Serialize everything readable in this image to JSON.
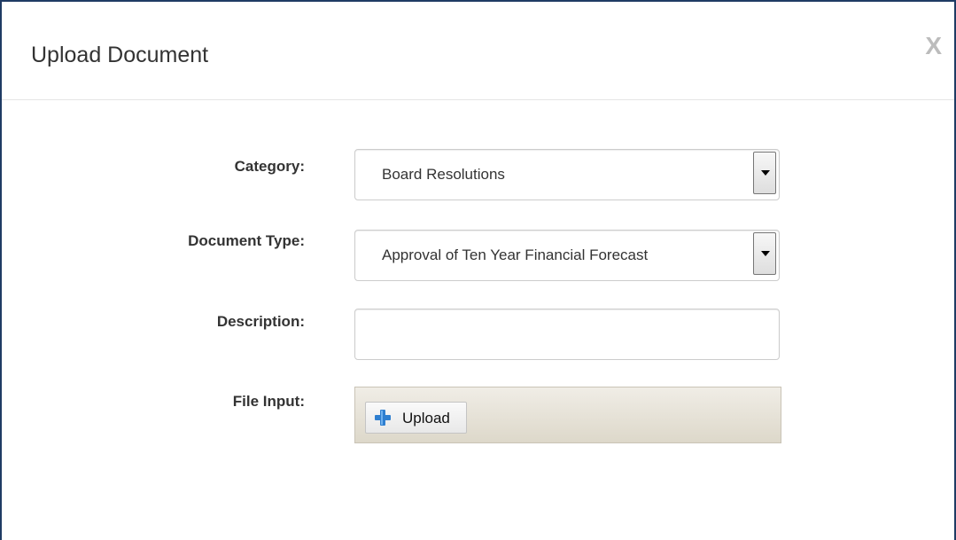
{
  "dialog": {
    "title": "Upload Document",
    "close_label": "X"
  },
  "form": {
    "category": {
      "label": "Category:",
      "value": "Board Resolutions"
    },
    "document_type": {
      "label": "Document Type:",
      "value": "Approval of Ten Year Financial Forecast"
    },
    "description": {
      "label": "Description:",
      "value": ""
    },
    "file_input": {
      "label": "File Input:",
      "button_label": "Upload",
      "button_icon": "plus-icon"
    }
  },
  "colors": {
    "frame_border": "#1f3b64",
    "close_color": "#bcbcbc",
    "plus_icon": "#2f7fd0",
    "upload_bar": "#e6e2d8"
  }
}
